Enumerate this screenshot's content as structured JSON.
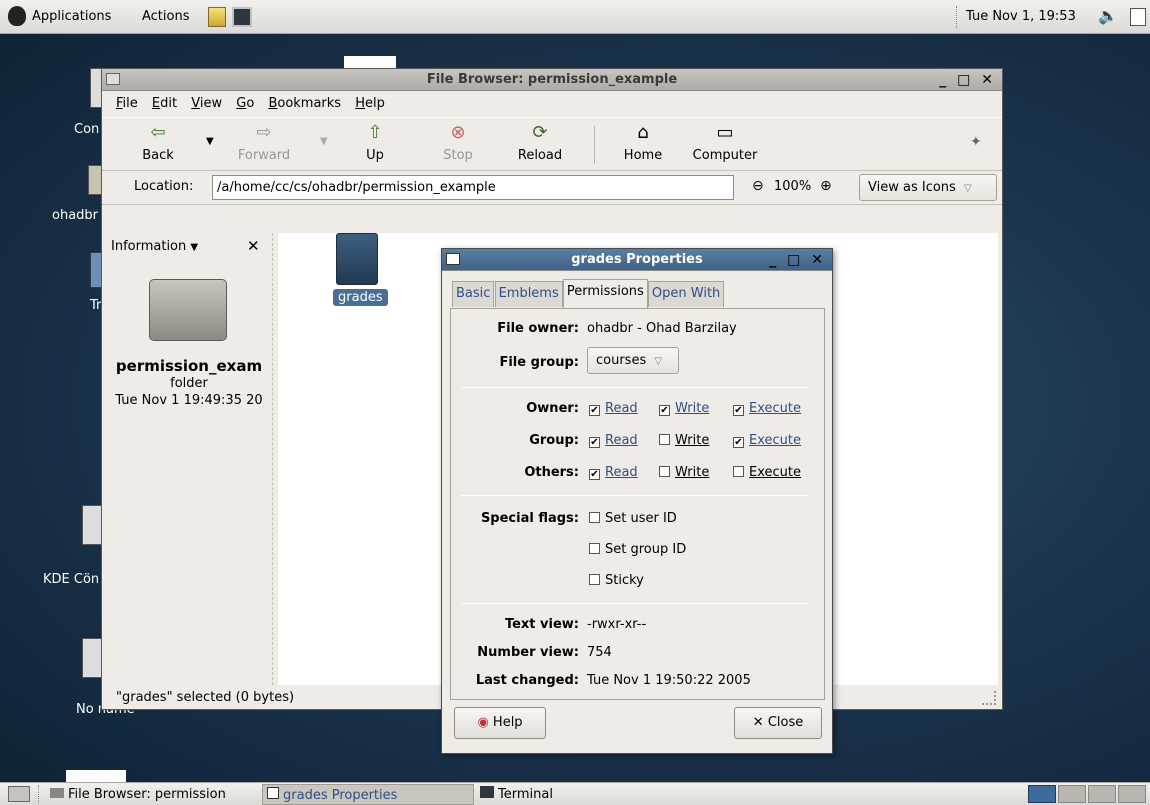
{
  "top_panel": {
    "applications": "Applications",
    "actions": "Actions",
    "clock": "Tue Nov  1, 19:53"
  },
  "desktop": {
    "icons": [
      "Con",
      "ohadbr",
      "Tr",
      "KDE Cön",
      "No name"
    ]
  },
  "file_browser": {
    "title": "File Browser: permission_example",
    "menu": [
      "File",
      "Edit",
      "View",
      "Go",
      "Bookmarks",
      "Help"
    ],
    "toolbar": {
      "back": "Back",
      "forward": "Forward",
      "up": "Up",
      "stop": "Stop",
      "reload": "Reload",
      "home": "Home",
      "computer": "Computer"
    },
    "location_label": "Location:",
    "location_value": "/a/home/cc/cs/ohadbr/permission_example",
    "zoom": "100%",
    "view_as": "View as Icons",
    "side_pane": {
      "header": "Information",
      "folder_name": "permission_exam",
      "folder_type": "folder",
      "folder_date": "Tue Nov  1 19:49:35 20"
    },
    "file_item": "grades",
    "status": "\"grades\" selected (0 bytes)"
  },
  "properties": {
    "title": "grades Properties",
    "tabs": [
      "Basic",
      "Emblems",
      "Permissions",
      "Open With"
    ],
    "active_tab": "Permissions",
    "file_owner_label": "File owner:",
    "file_owner_value": "ohadbr - Ohad Barzilay",
    "file_group_label": "File group:",
    "file_group_value": "courses",
    "perm_rows": [
      {
        "label": "Owner:",
        "read": true,
        "write": true,
        "execute": true
      },
      {
        "label": "Group:",
        "read": true,
        "write": false,
        "execute": true
      },
      {
        "label": "Others:",
        "read": true,
        "write": false,
        "execute": false
      }
    ],
    "perm_labels": {
      "read": "Read",
      "write": "Write",
      "execute": "Execute"
    },
    "special_flags_label": "Special flags:",
    "flags": [
      {
        "label": "Set user ID",
        "checked": false
      },
      {
        "label": "Set group ID",
        "checked": false
      },
      {
        "label": "Sticky",
        "checked": false
      }
    ],
    "text_view_label": "Text view:",
    "text_view_value": "-rwxr-xr--",
    "number_view_label": "Number view:",
    "number_view_value": "754",
    "last_changed_label": "Last changed:",
    "last_changed_value": "Tue Nov  1 19:50:22 2005",
    "help_button": "Help",
    "close_button": "Close"
  },
  "taskbar": {
    "tasks": [
      "File Browser: permission",
      "grades Properties",
      "Terminal"
    ]
  }
}
